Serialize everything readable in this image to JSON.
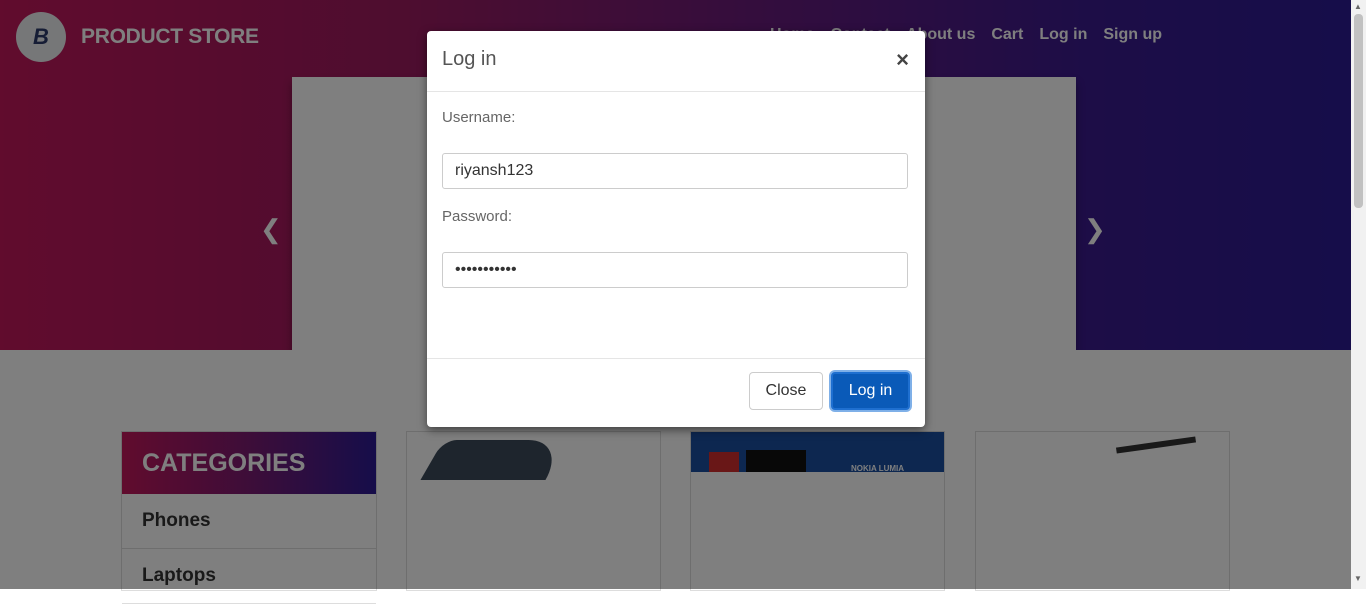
{
  "header": {
    "brand_logo_letter": "B",
    "brand_name": "PRODUCT STORE",
    "nav_items": [
      "Home",
      "Contact",
      "About us",
      "Cart",
      "Log in",
      "Sign up"
    ]
  },
  "categories": {
    "title": "CATEGORIES",
    "items": [
      "Phones",
      "Laptops"
    ]
  },
  "card2": {
    "image_text": "NOKIA LUMIA"
  },
  "login_modal": {
    "title": "Log in",
    "close_x": "×",
    "username_label": "Username:",
    "username_value": "riyansh123",
    "password_label": "Password:",
    "password_value": "•••••••••••",
    "close_button": "Close",
    "login_button": "Log in"
  },
  "colors": {
    "hero_start": "#c2185b",
    "hero_end": "#2c1a94",
    "primary_button": "#0a5ab8"
  },
  "icons": {
    "prev": "chevron-left-icon",
    "next": "chevron-right-icon"
  }
}
